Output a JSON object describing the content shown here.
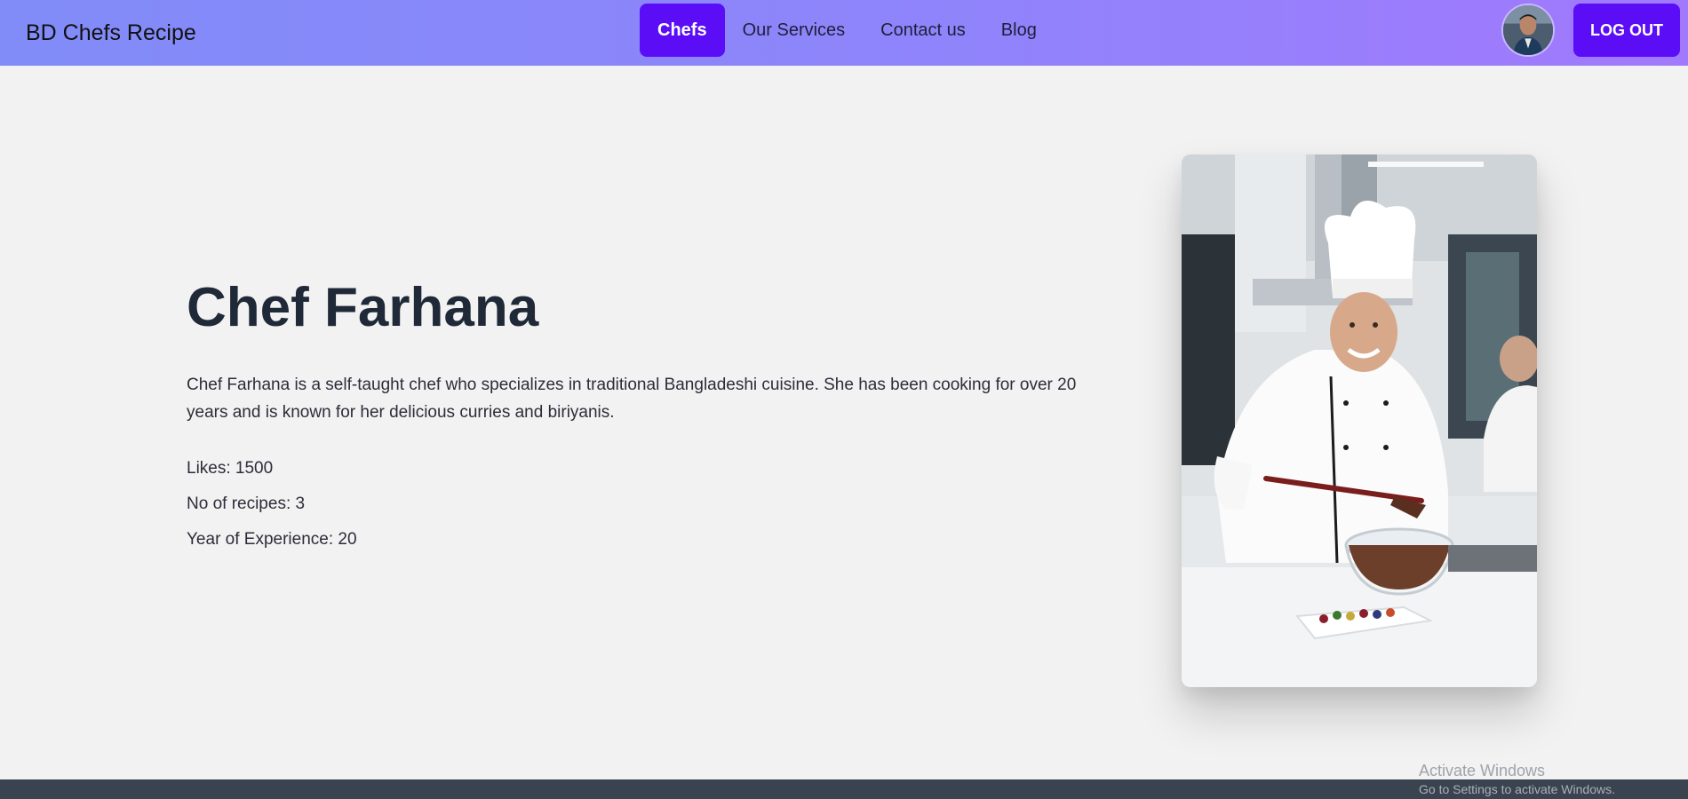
{
  "brand": {
    "title": "BD Chefs Recipe"
  },
  "nav": {
    "items": [
      {
        "label": "Chefs",
        "active": true
      },
      {
        "label": "Our Services",
        "active": false
      },
      {
        "label": "Contact us",
        "active": false
      },
      {
        "label": "Blog",
        "active": false
      }
    ]
  },
  "user": {
    "logout_label": "LOG OUT"
  },
  "chef": {
    "name": "Chef Farhana",
    "bio": "Chef Farhana is a self-taught chef who specializes in traditional Bangladeshi cuisine. She has been cooking for over 20 years and is known for her delicious curries and biriyanis.",
    "likes": "Likes: 1500",
    "recipes": "No of recipes: 3",
    "experience": "Year of Experience: 20"
  },
  "windows_watermark": {
    "title": "Activate Windows",
    "subtitle": "Go to Settings to activate Windows."
  },
  "colors": {
    "accent": "#5b0ef6",
    "navbar_start": "#818cf8",
    "navbar_end": "#a179fc",
    "background": "#f2f2f2",
    "footer": "#3a4350"
  }
}
